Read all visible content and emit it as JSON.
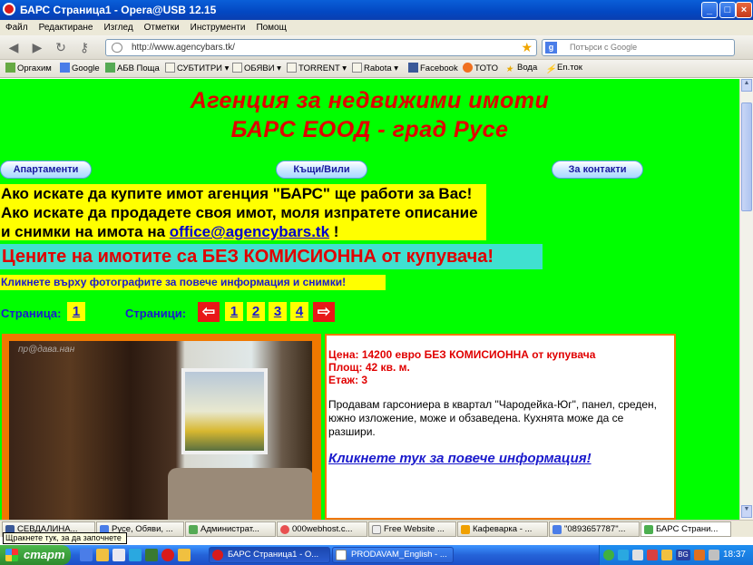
{
  "window": {
    "title": "БАРС Страница1 - Opera@USB 12.15",
    "buttons": [
      "_",
      "□",
      "×"
    ]
  },
  "menu": [
    "Файл",
    "Редактиране",
    "Изглед",
    "Отметки",
    "Инструменти",
    "Помощ"
  ],
  "toolbar": {
    "url": "http://www.agencybars.tk/",
    "search_placeholder": "Потърси с Google"
  },
  "bookmarks": [
    "Оргахим",
    "Google",
    "АБВ Поща",
    "СУБТИТРИ",
    "ОБЯВИ",
    "TORRENT",
    "Rabota",
    "Facebook",
    "TOTO",
    "Вода",
    "En.ток"
  ],
  "page": {
    "heading_line1": "Агенция  за  недвижими  имоти",
    "heading_line2": "БАРС  ЕООД - град Русе",
    "nav": {
      "apartments": "Апартаменти",
      "houses": "Къщи/Вили",
      "contacts": "За контакти"
    },
    "intro_line1": "Ако искате да купите имот агенция \"БАРС\" ще работи за Вас!",
    "intro_line2": "Ако искате да продадете своя имот, моля изпратете описание",
    "intro_line3_prefix": "и снимки на имота на",
    "intro_email": "office@agencybars.tk",
    "intro_line3_suffix": " !",
    "no_commission": "Цените на имотите са БЕЗ КОМИСИОННА от купувача!",
    "click_hint": "Кликнете върху фотографите за повече информация и снимки!",
    "page_label": "Страница:",
    "current_page": "1",
    "pages_label": "Страници:",
    "pages": [
      "1",
      "2",
      "3",
      "4"
    ],
    "prev_arrow": "⇦",
    "next_arrow": "⇨",
    "photo_watermark": "пр@дава.нан",
    "listing": {
      "price": "Цена: 14200 евро БЕЗ КОМИСИОННА от купувача",
      "area": "Площ: 42 кв. м.",
      "floor": "Етаж: 3",
      "description": "Продавам гарсониера в квартал \"Чародейка-Юг\", панел, среден, южно изложение, може и обзаведена. Кухнята може да се разшири.",
      "more_link": "Кликнете тук за повече информация!"
    }
  },
  "tabs": [
    "СЕВДАЛИНА...",
    "Русе, Обяви, ...",
    "Администрат...",
    "000webhost.c...",
    "Free Website ...",
    "Кафеварка - ...",
    "\"0893657787\"...",
    "БАРС Страни..."
  ],
  "tooltip": "Щракнете тук, за да започнете",
  "taskbar": {
    "start": "старт",
    "windows": [
      "БАРС Страница1 - О...",
      "PRODAVAM_English - ..."
    ],
    "tray_language": "BG",
    "clock": "18:37"
  },
  "colors": {
    "page_bg": "#00ff00",
    "heading": "#e00000",
    "highlight": "#ffff00",
    "accent_box": "#40e0d0",
    "frame": "#f07800"
  }
}
